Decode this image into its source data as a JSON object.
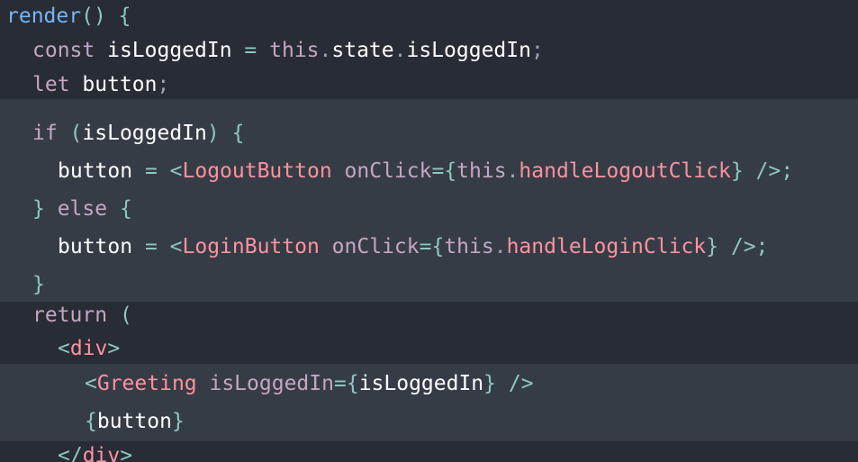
{
  "code": {
    "l1": {
      "kw": "render",
      "p1": "() {"
    },
    "l2": {
      "kw": "const",
      "id": " isLoggedIn",
      "op": " = ",
      "this": "this",
      "dot1": ".",
      "state": "state",
      "dot2": ".",
      "prop": "isLoggedIn",
      "semi": ";"
    },
    "l3": {
      "kw": "let",
      "id": " button",
      "semi": ";"
    },
    "l4": {
      "kw": "if",
      "p1": " (",
      "id": "isLoggedIn",
      "p2": ") {"
    },
    "l5": {
      "id": "button",
      "op": " = ",
      "lt": "<",
      "tag": "LogoutButton",
      "attr": " onClick",
      "eq": "=",
      "lb": "{",
      "this": "this",
      "dot": ".",
      "method": "handleLogoutClick",
      "rb": "}",
      "end": " />;"
    },
    "l6": {
      "p1": "} ",
      "kw": "else",
      "p2": " {"
    },
    "l7": {
      "id": "button",
      "op": " = ",
      "lt": "<",
      "tag": "LoginButton",
      "attr": " onClick",
      "eq": "=",
      "lb": "{",
      "this": "this",
      "dot": ".",
      "method": "handleLoginClick",
      "rb": "}",
      "end": " />;"
    },
    "l8": {
      "p1": "}"
    },
    "l9": {
      "kw": "return",
      "p1": " ("
    },
    "l10": {
      "lt": "<",
      "tag": "div",
      "gt": ">"
    },
    "l11": {
      "lt": "<",
      "tag": "Greeting",
      "attr": " isLoggedIn",
      "eq": "=",
      "lb": "{",
      "id": "isLoggedIn",
      "rb": "}",
      "end": " />"
    },
    "l12": {
      "lb": "{",
      "id": "button",
      "rb": "}"
    },
    "l13": {
      "lt": "</",
      "tag": "div",
      "gt": ">"
    }
  }
}
